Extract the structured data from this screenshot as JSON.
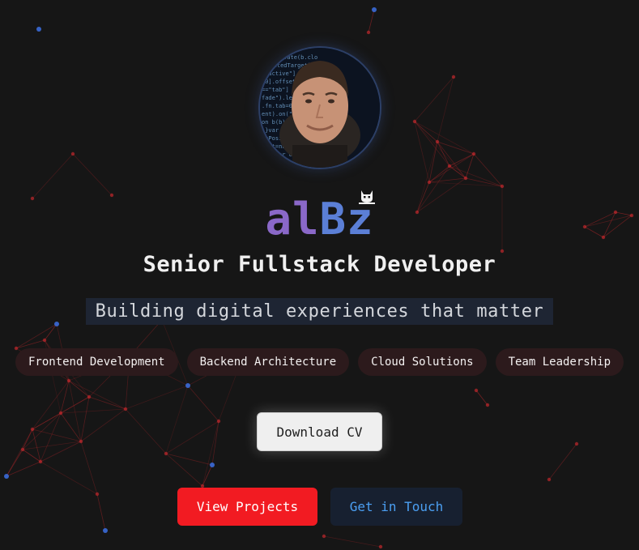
{
  "profile": {
    "avatar_alt": "profile photo",
    "logo_part1": "al",
    "logo_part2": "Bz",
    "title": "Senior Fullstack Developer",
    "tagline": "Building digital experiences that matter"
  },
  "skills": [
    "Frontend Development",
    "Backend Architecture",
    "Cloud Solutions",
    "Team Leadership"
  ],
  "actions": {
    "download_cv": "Download CV",
    "view_projects": "View Projects",
    "get_in_touch": "Get in Touch"
  },
  "colors": {
    "background": "#161616",
    "logo_purple": "#8a68c8",
    "logo_blue": "#5b7fd6",
    "accent_red": "#f21b22",
    "link_blue": "#4b9ff2",
    "network_red": "#c0282c",
    "network_blue": "#3a6ad8"
  },
  "icons": [
    "cat-icon"
  ]
}
